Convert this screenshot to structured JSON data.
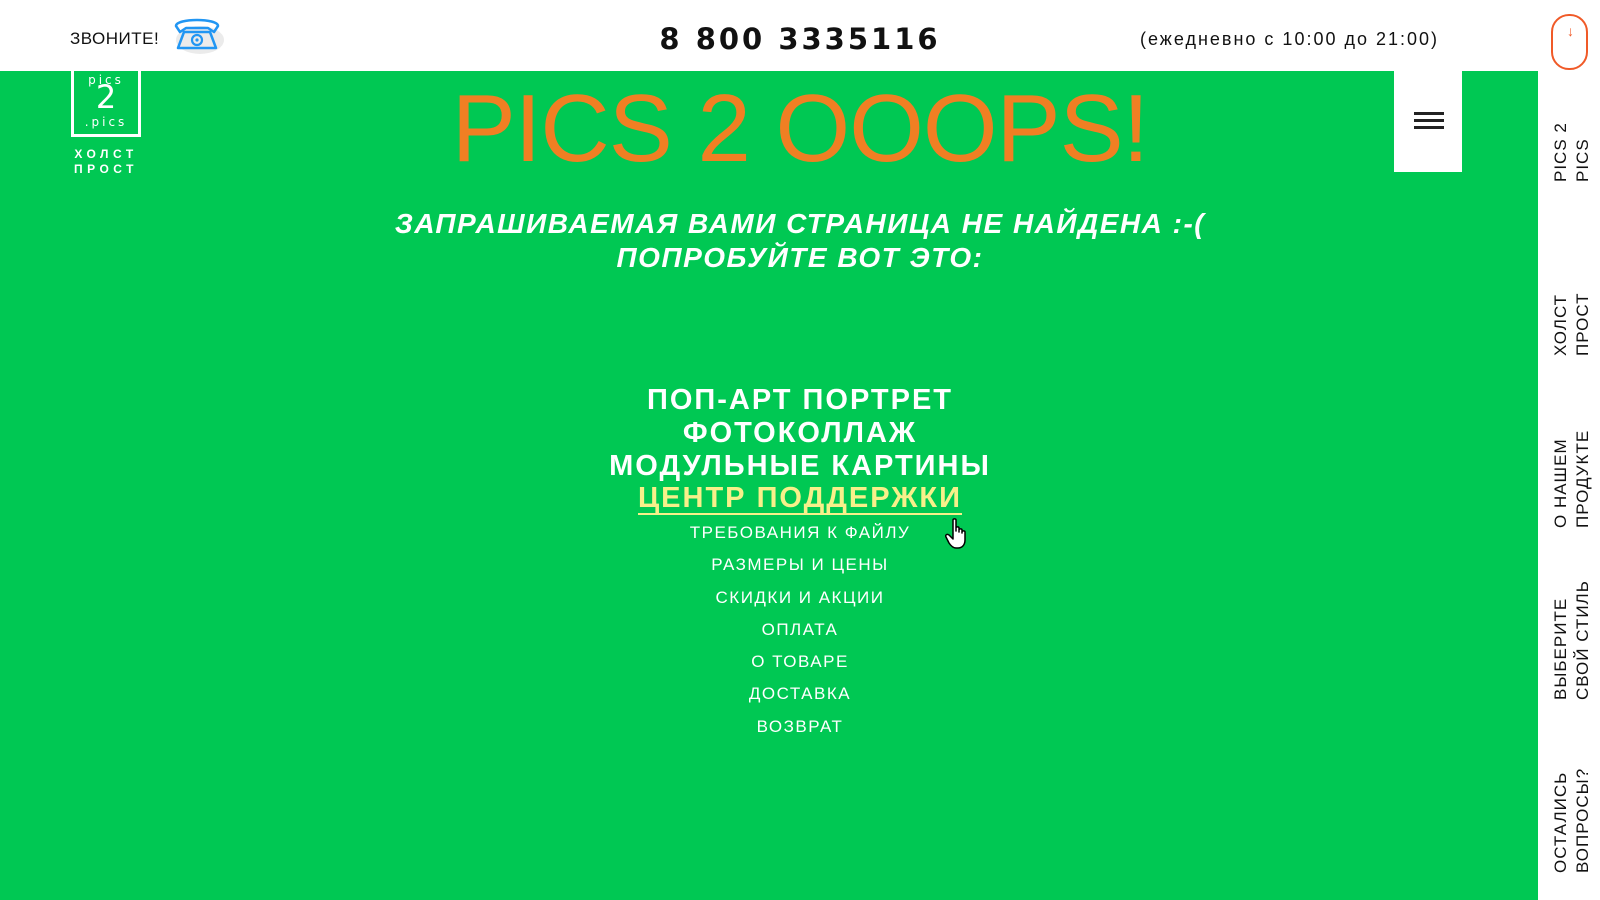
{
  "header": {
    "call_label": "ЗВОНИТЕ!",
    "phone_number": "8 800 3335116",
    "hours": "(ежедневно с 10:00 до 21:00)"
  },
  "logo": {
    "line1": "pics",
    "line2": "2",
    "line3": ".pics",
    "sub1": "ХОЛСТ",
    "sub2": "ПРОСТ"
  },
  "main": {
    "title": "PICS 2 OOOPS!",
    "message_line1": "ЗАПРАШИВАЕМАЯ ВАМИ СТРАНИЦА НЕ НАЙДЕНА :-(",
    "message_line2": "ПОПРОБУЙТЕ ВОТ ЭТО:",
    "big_links": [
      "ПОП-АРТ ПОРТРЕТ",
      "ФОТОКОЛЛАЖ",
      "МОДУЛЬНЫЕ КАРТИНЫ",
      "ЦЕНТР ПОДДЕРЖКИ"
    ],
    "sub_links": [
      "ТРЕБОВАНИЯ К ФАЙЛУ",
      "РАЗМЕРЫ И ЦЕНЫ",
      "СКИДКИ И АКЦИИ",
      "ОПЛАТА",
      "О ТОВАРЕ",
      "ДОСТАВКА",
      "ВОЗВРАТ"
    ]
  },
  "right_nav": {
    "items": [
      {
        "line1": "PICS 2",
        "line2": "PICS"
      },
      {
        "line1": "ХОЛСТ",
        "line2": "ПРОСТ"
      },
      {
        "line1": "О НАШЕМ",
        "line2": "ПРОДУКТЕ"
      },
      {
        "line1": "ВЫБЕРИТЕ",
        "line2": "СВОЙ СТИЛЬ"
      },
      {
        "line1": "ОСТАЛИСЬ",
        "line2": "ВОПРОСЫ?"
      }
    ]
  },
  "colors": {
    "background_green": "#00c853",
    "title_orange": "#f07f23",
    "active_link_yellow": "#f7f08a",
    "accent_red": "#f05a28"
  },
  "icons": {
    "phone": "telephone-icon",
    "menu": "hamburger-icon",
    "scroll": "scroll-mouse-icon",
    "cursor": "hand-pointer-icon"
  }
}
